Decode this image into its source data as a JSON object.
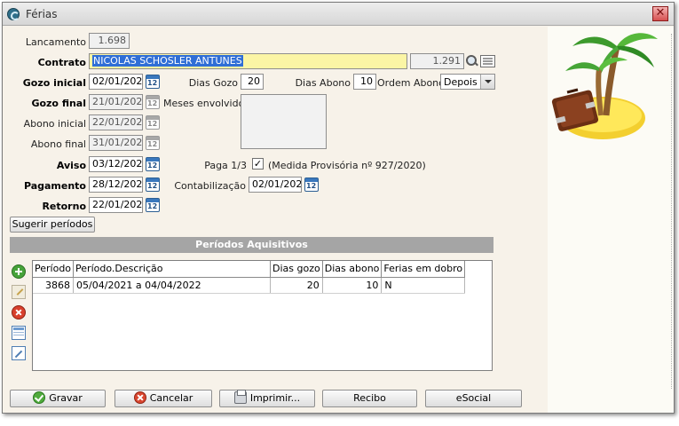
{
  "window": {
    "title": "Férias",
    "close_glyph": "✕"
  },
  "form": {
    "lancamento": {
      "label": "Lancamento",
      "value": "1.698"
    },
    "contrato": {
      "label": "Contrato",
      "name": "NICOLAS SCHOSLER ANTUNES",
      "code": "1.291"
    },
    "gozo_inicial": {
      "label": "Gozo inicial",
      "value": "02/01/2023"
    },
    "dias_gozo": {
      "label": "Dias Gozo",
      "value": "20"
    },
    "dias_abono": {
      "label": "Dias Abono",
      "value": "10"
    },
    "ordem_abono": {
      "label": "Ordem Abono",
      "value": "Depois"
    },
    "gozo_final": {
      "label": "Gozo final",
      "value": "21/01/2023"
    },
    "meses_envolvidos": {
      "label": "Meses envolvidos"
    },
    "abono_inicial": {
      "label": "Abono inicial",
      "value": "22/01/2023"
    },
    "abono_final": {
      "label": "Abono final",
      "value": "31/01/2023"
    },
    "aviso": {
      "label": "Aviso",
      "value": "03/12/2022"
    },
    "paga_1_3": {
      "label": "Paga 1/3",
      "checked_glyph": "✓",
      "note": "(Medida Provisória nº 927/2020)"
    },
    "pagamento": {
      "label": "Pagamento",
      "value": "28/12/2022"
    },
    "contabilizacao": {
      "label": "Contabilização",
      "value": "02/01/2023"
    },
    "retorno": {
      "label": "Retorno",
      "value": "22/01/2023"
    },
    "sugerir_label": "Sugerir períodos"
  },
  "periodos": {
    "title": "Períodos Aquisitivos",
    "columns": [
      "Período",
      "Período.Descrição",
      "Dias gozo",
      "Dias abono",
      "Ferias em dobro"
    ],
    "rows": [
      {
        "periodo": "3868",
        "descricao": "05/04/2021 a 04/04/2022",
        "dias_gozo": "20",
        "dias_abono": "10",
        "dobro": "N"
      }
    ]
  },
  "side_icons": [
    "add-icon",
    "edit-icon",
    "delete-icon",
    "grid-icon",
    "document-icon"
  ],
  "buttons": {
    "gravar": "Gravar",
    "cancelar": "Cancelar",
    "imprimir": "Imprimir...",
    "recibo": "Recibo",
    "esocial": "eSocial"
  },
  "colors": {
    "form_bg": "#f7f2e9",
    "highlight_field": "#fbf5a5",
    "selection": "#2f6ed6",
    "section_bar": "#a5a5a5"
  }
}
